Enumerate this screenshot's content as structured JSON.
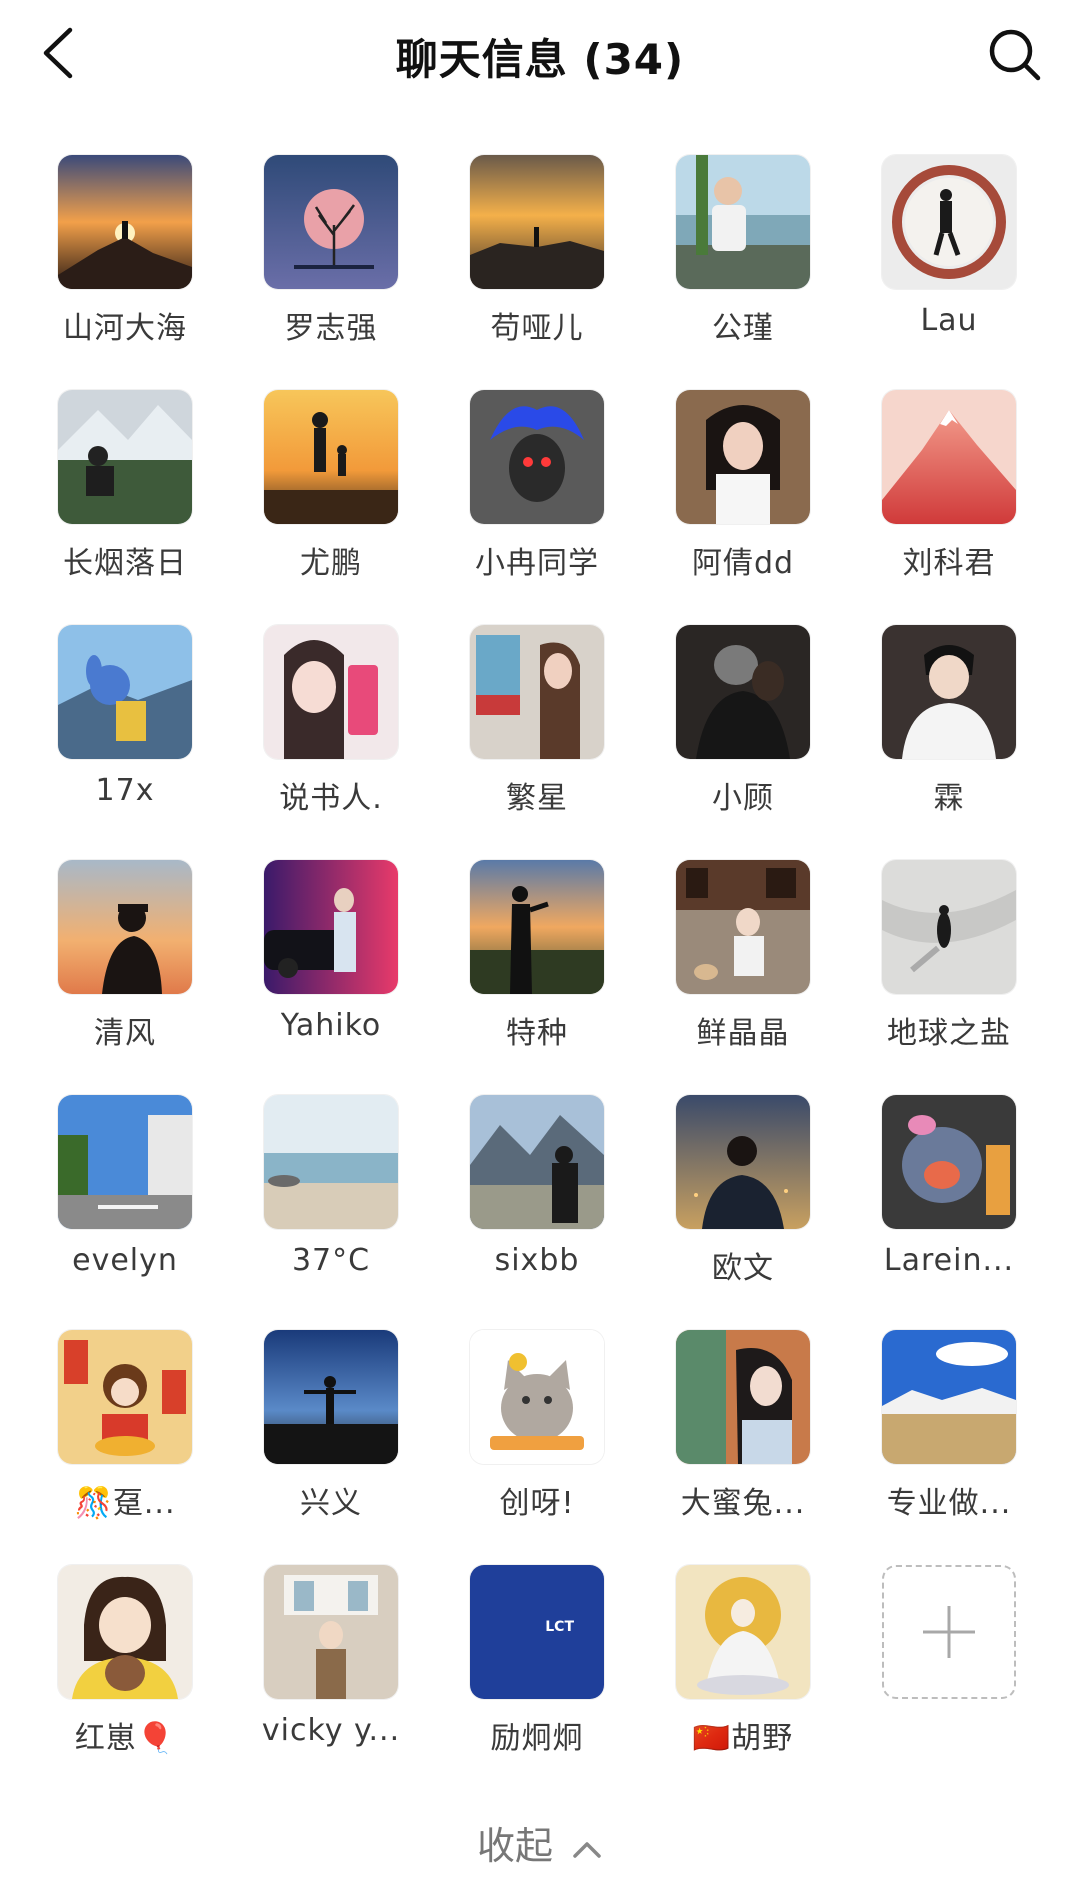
{
  "header": {
    "title": "聊天信息 (34)",
    "back_icon": "chevron-left-icon",
    "search_icon": "search-icon"
  },
  "members": [
    {
      "name": "山河大海",
      "avatar": "sunset-mountain-silhouette"
    },
    {
      "name": "罗志强",
      "avatar": "pink-tree-moon"
    },
    {
      "name": "苟哑儿",
      "avatar": "sunrise-peak"
    },
    {
      "name": "公瑾",
      "avatar": "boy-lakeside"
    },
    {
      "name": "Lau",
      "avatar": "walking-figure-circle"
    },
    {
      "name": "长烟落日",
      "avatar": "camper-mountains"
    },
    {
      "name": "尤鹏",
      "avatar": "parent-child-beach"
    },
    {
      "name": "小冉同学",
      "avatar": "blue-flame-head"
    },
    {
      "name": "阿倩dd",
      "avatar": "girl-selfie"
    },
    {
      "name": "刘科君",
      "avatar": "red-mountain"
    },
    {
      "name": "17x",
      "avatar": "stitch-mountain"
    },
    {
      "name": "说书人.",
      "avatar": "girl-drink"
    },
    {
      "name": "繁星",
      "avatar": "girl-street"
    },
    {
      "name": "小顾",
      "avatar": "girl-cat"
    },
    {
      "name": "霖",
      "avatar": "guy-white-shirt"
    },
    {
      "name": "清风",
      "avatar": "smoker-sunset"
    },
    {
      "name": "Yahiko",
      "avatar": "car-neon"
    },
    {
      "name": "特种",
      "avatar": "man-field-sunset"
    },
    {
      "name": "鲜晶晶",
      "avatar": "girl-dog"
    },
    {
      "name": "地球之盐",
      "avatar": "figure-snow"
    },
    {
      "name": "evelyn",
      "avatar": "street-sky"
    },
    {
      "name": "37°C",
      "avatar": "seaside"
    },
    {
      "name": "sixbb",
      "avatar": "terraces-mountain"
    },
    {
      "name": "欧文",
      "avatar": "city-night-man"
    },
    {
      "name": "Larein...",
      "avatar": "stitch-plush"
    },
    {
      "name": "🎊趸...",
      "avatar": "fortune-girl-cartoon"
    },
    {
      "name": "兴义",
      "avatar": "dusk-silhouette"
    },
    {
      "name": "创呀!",
      "avatar": "cat-sunflower"
    },
    {
      "name": "大蜜兔...",
      "avatar": "girl-cafe"
    },
    {
      "name": "专业做...",
      "avatar": "snow-plateau"
    },
    {
      "name": "红崽🎈",
      "avatar": "cartoon-girl-bear"
    },
    {
      "name": "vicky y...",
      "avatar": "girl-restaurant"
    },
    {
      "name": "励炯炯",
      "avatar": "lct-logo",
      "logo_text": "LCT"
    },
    {
      "name": "🇨🇳胡野",
      "avatar": "golden-deity"
    }
  ],
  "add_button": {
    "icon": "plus-icon"
  },
  "footer": {
    "collapse_label": "收起",
    "collapse_icon": "chevron-up-icon"
  },
  "colors": {
    "title": "#111111",
    "member_name": "#3a3a3a",
    "collapse": "#777777",
    "dashed_border": "#bdbdbd"
  }
}
